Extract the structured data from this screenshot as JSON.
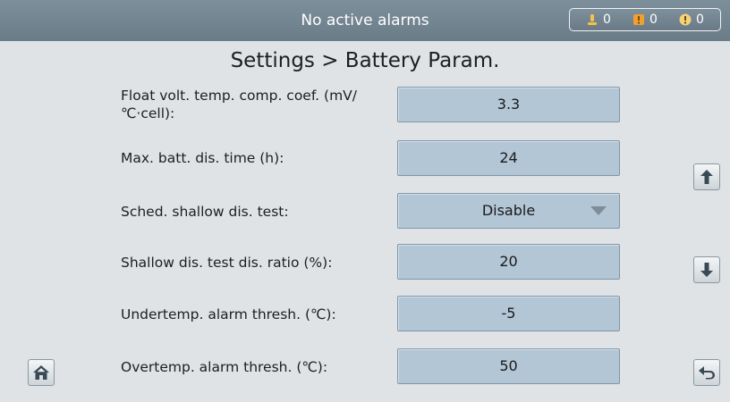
{
  "header": {
    "alarm_status": "No active alarms",
    "counters": [
      {
        "icon": "minor-alarm-icon",
        "count": "0",
        "color": "#f2c24a"
      },
      {
        "icon": "major-alarm-icon",
        "count": "0",
        "color": "#f0a030"
      },
      {
        "icon": "critical-alarm-icon",
        "count": "0",
        "color": "#e0452e"
      }
    ]
  },
  "page": {
    "title": "Settings > Battery Param."
  },
  "settings": [
    {
      "label": "Float volt. temp. comp. coef. (mV/℃·cell):",
      "value": "3.3"
    },
    {
      "label": "Max. batt. dis. time (h):",
      "value": "24"
    },
    {
      "label": "Sched. shallow dis. test:",
      "value": "Disable",
      "type": "dropdown"
    },
    {
      "label": "Shallow dis. test dis. ratio (%):",
      "value": "20"
    },
    {
      "label": "Undertemp. alarm thresh. (℃):",
      "value": "-5"
    },
    {
      "label": "Overtemp. alarm thresh. (℃):",
      "value": "50"
    }
  ],
  "nav": {
    "scroll_up_icon": "arrow-up-icon",
    "scroll_down_icon": "arrow-down-icon",
    "home_icon": "home-icon",
    "back_icon": "back-arrow-icon"
  }
}
